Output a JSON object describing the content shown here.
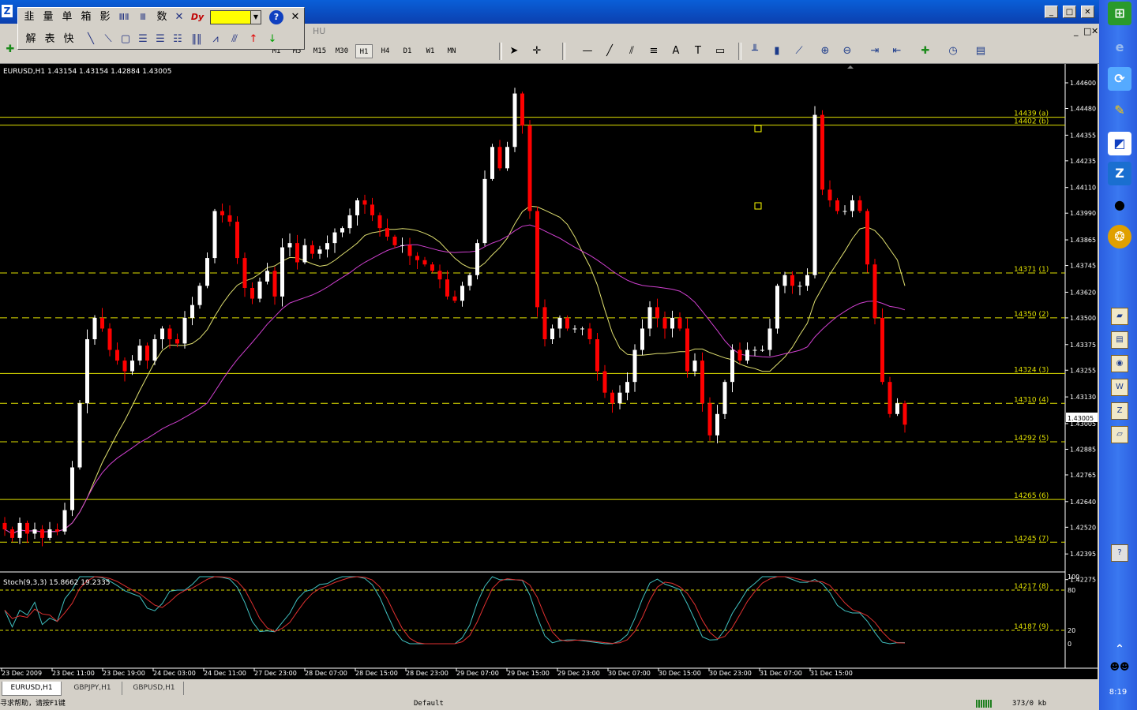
{
  "window": {
    "app_icon": "Z",
    "minimize": "_",
    "maximize": "□",
    "close": "✕",
    "restore_glyph": "□"
  },
  "menu": {
    "right_items": [
      "HU"
    ],
    "right_close": "✕"
  },
  "float_toolbar": {
    "row1": [
      "韭",
      "量",
      "单",
      "箱",
      "影",
      "ⅢⅡ",
      "Ⅲ",
      "数",
      "✕",
      "Dy"
    ],
    "row2": [
      "解",
      "表",
      "快"
    ],
    "color": "#ffff00",
    "help": "?",
    "close": "✕"
  },
  "timeframes": {
    "items": [
      "M1",
      "M5",
      "M15",
      "M30",
      "H1",
      "H4",
      "D1",
      "W1",
      "MN"
    ],
    "active": "H1"
  },
  "chart": {
    "symbol_header": "EURUSD,H1  1.43154 1.43154 1.42884 1.43005",
    "current_price": "1.43005",
    "stoch_header": "Stoch(9,3,3) 15.8662 19.2335"
  },
  "chart_data": {
    "type": "candlestick",
    "symbol": "EURUSD",
    "timeframe": "H1",
    "ohlc_last": {
      "open": 1.43154,
      "high": 1.43154,
      "low": 1.42884,
      "close": 1.43005
    },
    "y_ticks": [
      "1.44600",
      "1.44480",
      "1.44355",
      "1.44235",
      "1.44110",
      "1.43990",
      "1.43865",
      "1.43745",
      "1.43620",
      "1.43500",
      "1.43375",
      "1.43255",
      "1.43130",
      "1.43005",
      "1.42885",
      "1.42765",
      "1.42640",
      "1.42520",
      "1.42395",
      "1.42275"
    ],
    "y_tick_values": [
      1.446,
      1.4448,
      1.44355,
      1.44235,
      1.4411,
      1.4399,
      1.43865,
      1.43745,
      1.4362,
      1.435,
      1.43375,
      1.43255,
      1.4313,
      1.43005,
      1.42885,
      1.42765,
      1.4264,
      1.4252,
      1.42395,
      1.42275
    ],
    "x_ticks": [
      "23 Dec 2009",
      "23 Dec 11:00",
      "23 Dec 19:00",
      "24 Dec 03:00",
      "24 Dec 11:00",
      "27 Dec 23:00",
      "28 Dec 07:00",
      "28 Dec 15:00",
      "28 Dec 23:00",
      "29 Dec 07:00",
      "29 Dec 15:00",
      "29 Dec 23:00",
      "30 Dec 07:00",
      "30 Dec 15:00",
      "30 Dec 23:00",
      "31 Dec 07:00",
      "31 Dec 15:00"
    ],
    "levels": [
      {
        "price": 1.44439,
        "label": "14439 (a)",
        "style": "solid"
      },
      {
        "price": 1.44402,
        "label": "14402 (b)",
        "style": "solid"
      },
      {
        "price": 1.4371,
        "label": "14371 (1)",
        "style": "dashed"
      },
      {
        "price": 1.435,
        "label": "14350 (2)",
        "style": "dashed"
      },
      {
        "price": 1.4324,
        "label": "14324 (3)",
        "style": "solid"
      },
      {
        "price": 1.431,
        "label": "14310 (4)",
        "style": "dashed"
      },
      {
        "price": 1.4292,
        "label": "14292 (5)",
        "style": "dashed"
      },
      {
        "price": 1.4265,
        "label": "14265 (6)",
        "style": "solid"
      },
      {
        "price": 1.4245,
        "label": "14245 (7)",
        "style": "dashed"
      }
    ],
    "osc_levels": [
      {
        "label": "14217 (8)",
        "value": 80
      },
      {
        "label": "14187 (9)",
        "value": 20
      }
    ],
    "stoch_ticks": [
      "100",
      "80",
      "20",
      "0"
    ],
    "stoch": {
      "k": 15.8662,
      "d": 19.2335
    },
    "colors": {
      "bull": "#ffffff",
      "bear": "#ff0000",
      "level": "#e0e000",
      "ma_fast": "#e0e070",
      "ma_slow": "#d040d0",
      "stoch_main": "#40c0c0",
      "stoch_signal": "#e03030"
    },
    "closes": [
      1.4251,
      1.4247,
      1.4254,
      1.4249,
      1.4251,
      1.4247,
      1.4251,
      1.425,
      1.426,
      1.428,
      1.431,
      1.434,
      1.435,
      1.4345,
      1.4335,
      1.433,
      1.4325,
      1.433,
      1.4337,
      1.433,
      1.434,
      1.4345,
      1.434,
      1.4338,
      1.435,
      1.4356,
      1.4365,
      1.4378,
      1.44,
      1.4398,
      1.4395,
      1.4378,
      1.4364,
      1.4359,
      1.4367,
      1.4372,
      1.436,
      1.4383,
      1.4385,
      1.4376,
      1.4384,
      1.438,
      1.4382,
      1.4385,
      1.439,
      1.4392,
      1.4398,
      1.4405,
      1.4403,
      1.4398,
      1.4392,
      1.4388,
      1.4384,
      1.4384,
      1.4379,
      1.4377,
      1.4375,
      1.4372,
      1.4368,
      1.436,
      1.4358,
      1.4365,
      1.437,
      1.4385,
      1.4415,
      1.443,
      1.442,
      1.443,
      1.4455,
      1.444,
      1.44,
      1.4355,
      1.434,
      1.4345,
      1.435,
      1.4345,
      1.4345,
      1.4345,
      1.434,
      1.4325,
      1.4315,
      1.431,
      1.4315,
      1.432,
      1.4335,
      1.4345,
      1.4355,
      1.435,
      1.4345,
      1.435,
      1.4345,
      1.4325,
      1.433,
      1.431,
      1.4295,
      1.4305,
      1.432,
      1.4335,
      1.433,
      1.4335,
      1.4335,
      1.4335,
      1.4345,
      1.4365,
      1.437,
      1.4365,
      1.4365,
      1.437,
      1.4445,
      1.441,
      1.4405,
      1.44,
      1.44,
      1.4405,
      1.44,
      1.4375,
      1.435,
      1.432,
      1.4305,
      1.431,
      1.43
    ]
  },
  "tabs": [
    {
      "label": "EURUSD,H1",
      "active": true
    },
    {
      "label": "GBPJPY,H1",
      "active": false
    },
    {
      "label": "GBPUSD,H1",
      "active": false
    }
  ],
  "status": {
    "help": "寻求帮助，请按F1键",
    "profile": "Default",
    "traffic": "373/0 kb"
  },
  "quicklaunch": {
    "clock": "8:19"
  }
}
